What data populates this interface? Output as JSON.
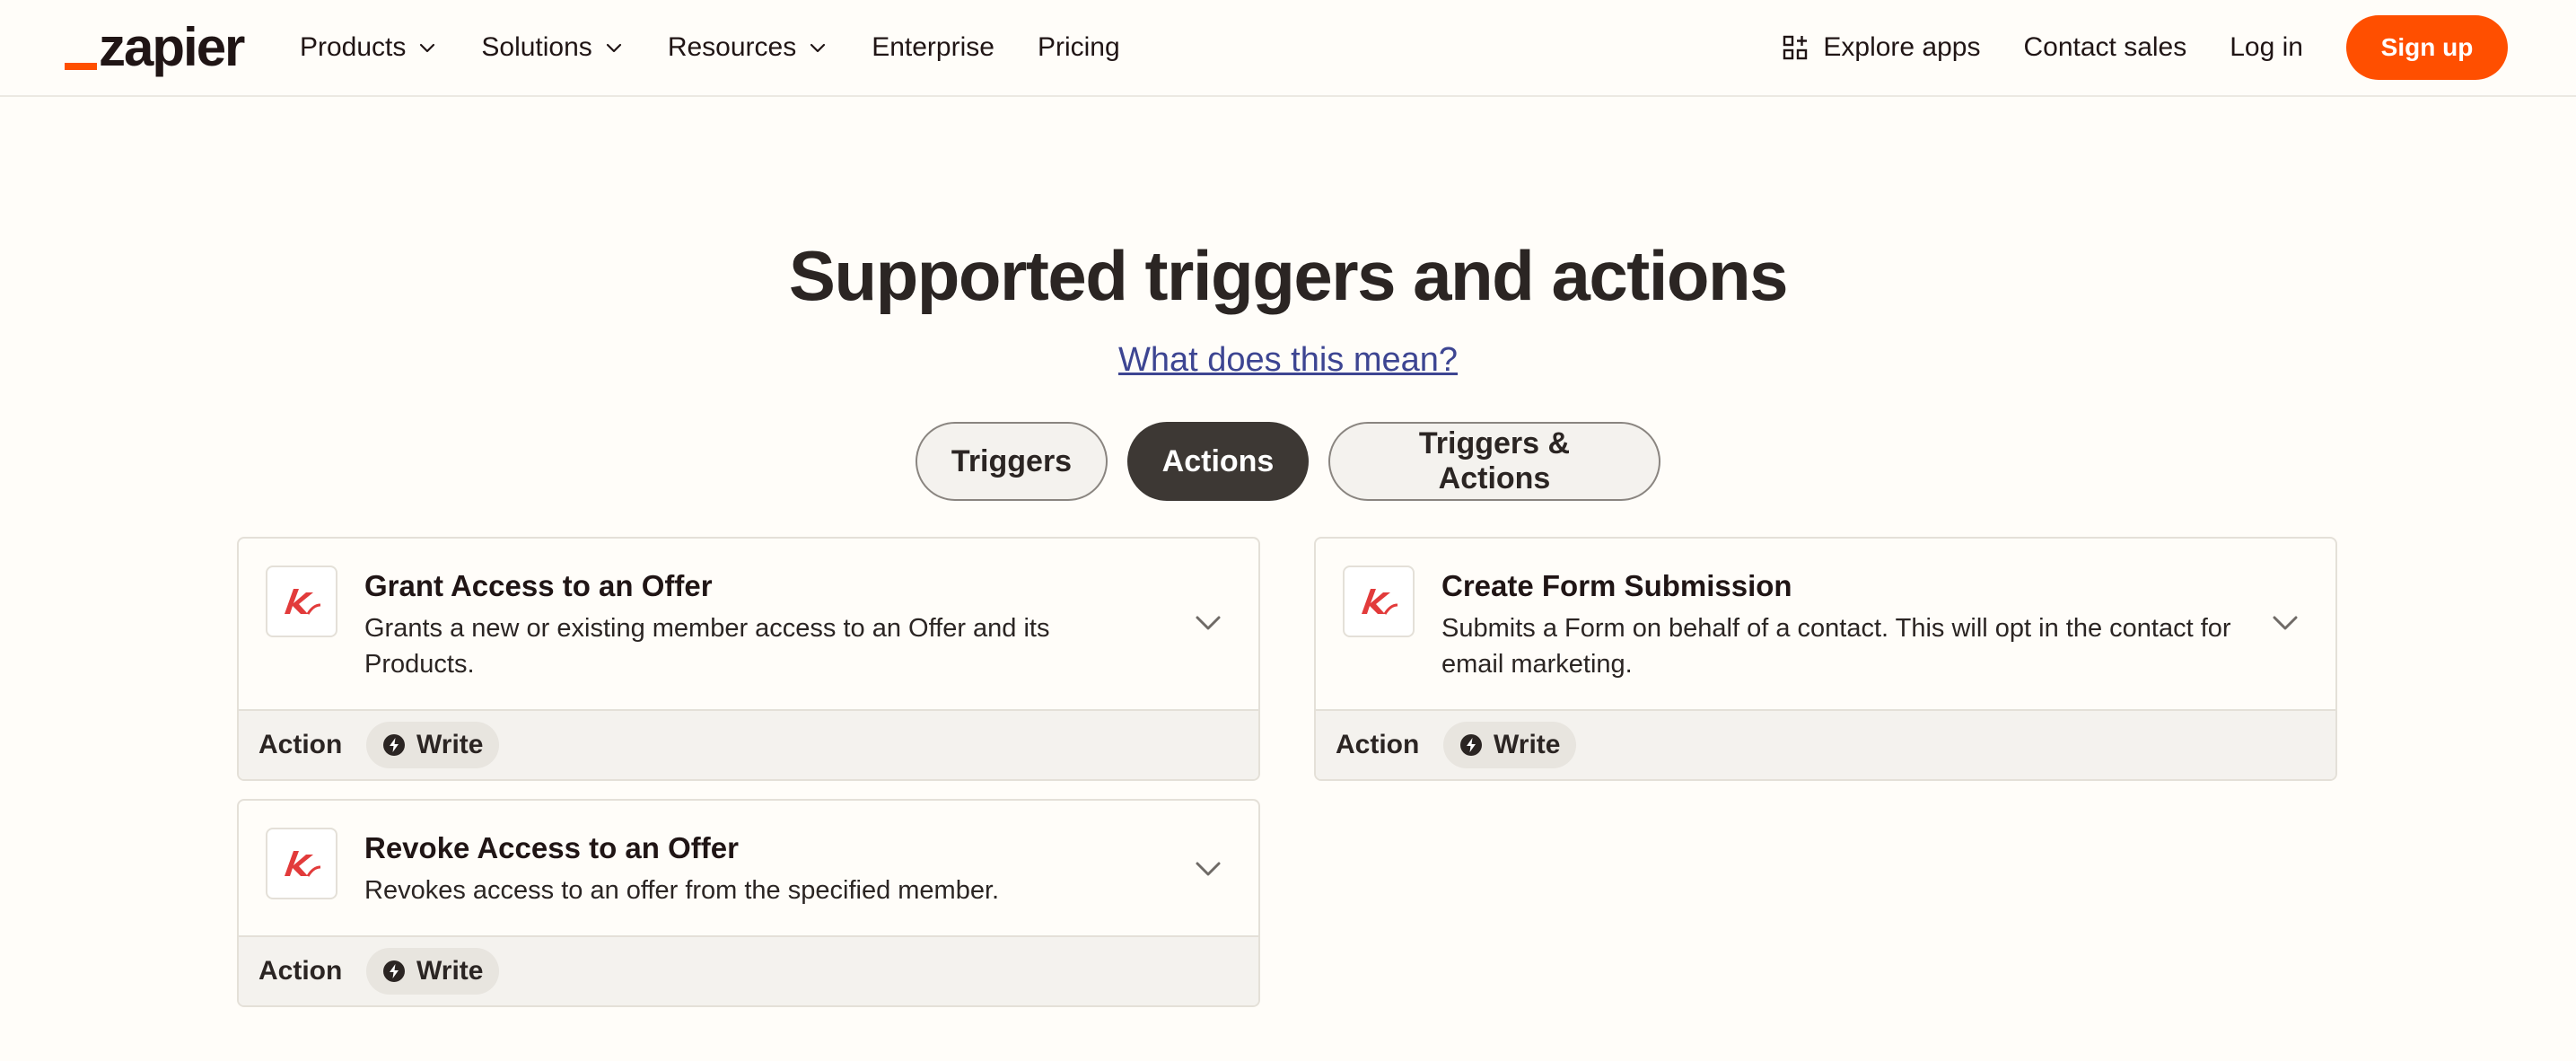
{
  "header": {
    "logo_text": "zapier",
    "nav": [
      {
        "label": "Products"
      },
      {
        "label": "Solutions"
      },
      {
        "label": "Resources"
      },
      {
        "label": "Enterprise"
      },
      {
        "label": "Pricing"
      }
    ],
    "explore_apps": "Explore apps",
    "contact_sales": "Contact sales",
    "log_in": "Log in",
    "sign_up": "Sign up"
  },
  "section": {
    "title": "Supported triggers and actions",
    "help_link": "What does this mean?",
    "tabs": [
      {
        "label": "Triggers",
        "active": false
      },
      {
        "label": "Actions",
        "active": true
      },
      {
        "label": "Triggers & Actions",
        "active": false
      }
    ]
  },
  "cards": [
    {
      "title": "Grant Access to an Offer",
      "description": "Grants a new or existing member access to an Offer and its Products.",
      "type_label": "Action",
      "badge": "Write"
    },
    {
      "title": "Create Form Submission",
      "description": "Submits a Form on behalf of a contact. This will opt in the contact for email marketing.",
      "type_label": "Action",
      "badge": "Write"
    },
    {
      "title": "Revoke Access to an Offer",
      "description": "Revokes access to an offer from the specified member.",
      "type_label": "Action",
      "badge": "Write"
    }
  ],
  "icons": {
    "app": "kajabi-logo-icon",
    "expand": "chevron-down-icon",
    "write": "lightning-bolt-icon",
    "explore": "apps-grid-icon"
  },
  "colors": {
    "brand_orange": "#ff4f00",
    "active_tab": "#3d3834",
    "link": "#3d4592",
    "app_red": "#e23b3b"
  }
}
